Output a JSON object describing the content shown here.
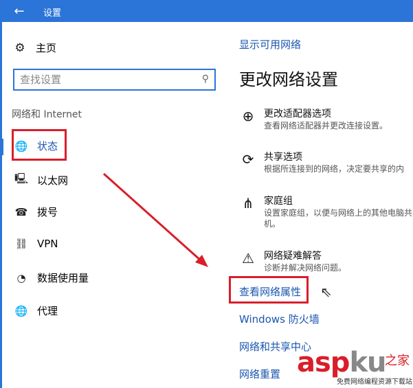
{
  "window": {
    "title": "设置",
    "back_glyph": "←"
  },
  "sidebar": {
    "home_label": "主页",
    "search_placeholder": "查找设置",
    "section_label": "网络和 Internet",
    "items": [
      {
        "label": "状态",
        "icon": "globe-icon",
        "glyph": "🌐"
      },
      {
        "label": "以太网",
        "icon": "ethernet-icon",
        "glyph": "🖳"
      },
      {
        "label": "拨号",
        "icon": "dialup-icon",
        "glyph": "☎"
      },
      {
        "label": "VPN",
        "icon": "vpn-icon",
        "glyph": "⛓"
      },
      {
        "label": "数据使用量",
        "icon": "data-usage-icon",
        "glyph": "◔"
      },
      {
        "label": "代理",
        "icon": "proxy-icon",
        "glyph": "🌐"
      }
    ]
  },
  "main": {
    "show_networks_link": "显示可用网络",
    "heading": "更改网络设置",
    "options": [
      {
        "title": "更改适配器选项",
        "desc": "查看网络适配器并更改连接设置。",
        "icon": "adapter-icon",
        "glyph": "⊕"
      },
      {
        "title": "共享选项",
        "desc": "根据所连接到的网络，决定要共享的内",
        "icon": "share-icon",
        "glyph": "⟳"
      },
      {
        "title": "家庭组",
        "desc": "设置家庭组，以便与网络上的其他电脑共享机。",
        "icon": "homegroup-icon",
        "glyph": "⋔"
      },
      {
        "title": "网络疑难解答",
        "desc": "诊断并解决网络问题。",
        "icon": "warning-icon",
        "glyph": "⚠"
      }
    ],
    "links": [
      "查看网络属性",
      "Windows 防火墙",
      "网络和共享中心",
      "网络重置"
    ]
  },
  "watermark": {
    "brand": "asp",
    "brand2": "ku",
    "suffix": "之家",
    "tagline": "免费网络编程资源下载站"
  },
  "colors": {
    "accent": "#2b74d8",
    "link": "#1a56b0",
    "highlight": "#d91e2a"
  }
}
